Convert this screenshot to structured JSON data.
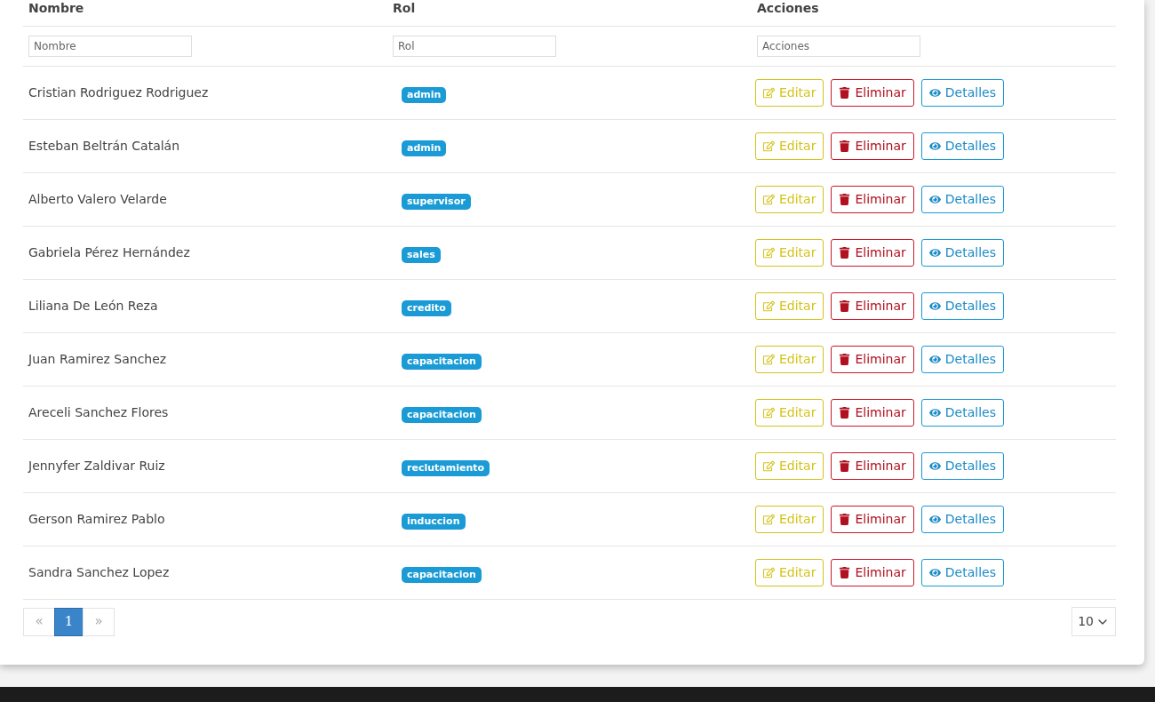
{
  "table": {
    "columns": [
      "Nombre",
      "Rol",
      "Acciones"
    ],
    "filters": [
      {
        "placeholder": "Nombre"
      },
      {
        "placeholder": "Rol"
      },
      {
        "placeholder": "Acciones"
      }
    ],
    "rows": [
      {
        "name": "Cristian Rodriguez Rodriguez",
        "role": "admin",
        "actions": [
          "Editar",
          "Eliminar",
          "Detalles"
        ]
      },
      {
        "name": "Esteban Beltrán Catalán",
        "role": "admin",
        "actions": [
          "Editar",
          "Eliminar",
          "Detalles"
        ]
      },
      {
        "name": "Alberto Valero Velarde",
        "role": "supervisor",
        "actions": [
          "Editar",
          "Eliminar",
          "Detalles"
        ]
      },
      {
        "name": "Gabriela Pérez Hernández",
        "role": "sales",
        "actions": [
          "Editar",
          "Eliminar",
          "Detalles"
        ]
      },
      {
        "name": "Liliana De León Reza",
        "role": "credito",
        "actions": [
          "Editar",
          "Eliminar",
          "Detalles"
        ]
      },
      {
        "name": "Juan Ramirez Sanchez",
        "role": "capacitacion",
        "actions": [
          "Editar",
          "Eliminar",
          "Detalles"
        ]
      },
      {
        "name": "Areceli Sanchez Flores",
        "role": "capacitacion",
        "actions": [
          "Editar",
          "Eliminar",
          "Detalles"
        ]
      },
      {
        "name": "Jennyfer Zaldivar Ruiz",
        "role": "reclutamiento",
        "actions": [
          "Editar",
          "Eliminar",
          "Detalles"
        ]
      },
      {
        "name": "Gerson Ramirez Pablo",
        "role": "induccion",
        "actions": [
          "Editar",
          "Eliminar",
          "Detalles"
        ]
      },
      {
        "name": "Sandra Sanchez Lopez",
        "role": "capacitacion",
        "actions": [
          "Editar",
          "Eliminar",
          "Detalles"
        ]
      }
    ]
  },
  "pagination": {
    "prev": {
      "label": "«",
      "disabled": true
    },
    "pages": [
      {
        "label": "1",
        "selected": true
      }
    ],
    "next": {
      "label": "»",
      "disabled": true
    },
    "page_size": "10"
  }
}
